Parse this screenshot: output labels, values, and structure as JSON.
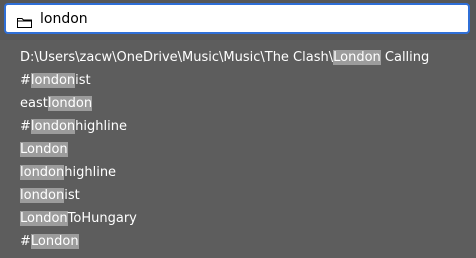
{
  "search": {
    "value": "london",
    "icon": "folder-icon"
  },
  "results": [
    {
      "pre": "D:\\Users\\zacw\\OneDrive\\Music\\Music\\The Clash\\",
      "match": "London",
      "post": " Calling"
    },
    {
      "pre": "#",
      "match": "london",
      "post": "ist"
    },
    {
      "pre": "east",
      "match": "london",
      "post": ""
    },
    {
      "pre": "#",
      "match": "london",
      "post": "highline"
    },
    {
      "pre": "",
      "match": "London",
      "post": ""
    },
    {
      "pre": "",
      "match": "london",
      "post": "highline"
    },
    {
      "pre": "",
      "match": "london",
      "post": "ist"
    },
    {
      "pre": "",
      "match": "London",
      "post": "ToHungary"
    },
    {
      "pre": "#",
      "match": "London",
      "post": ""
    }
  ],
  "colors": {
    "accent": "#2f6fd7",
    "highlight": "#9c9c9c",
    "background": "#5d5d5d"
  }
}
